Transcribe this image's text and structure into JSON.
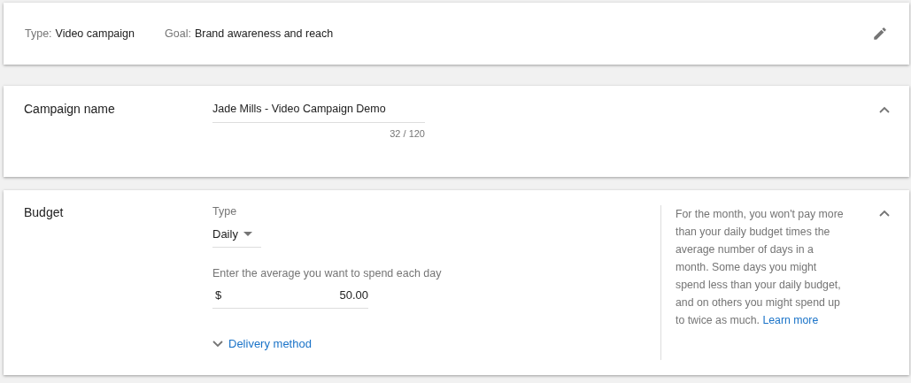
{
  "summary": {
    "items": [
      {
        "label": "Type:",
        "value": "Video campaign"
      },
      {
        "label": "Goal:",
        "value": "Brand awareness and reach"
      }
    ]
  },
  "campaign_name": {
    "title": "Campaign name",
    "expanded": true,
    "value": "Jade Mills - Video Campaign Demo",
    "counter": "32 / 120"
  },
  "budget": {
    "title": "Budget",
    "expanded": true,
    "type_label": "Type",
    "type_value": "Daily",
    "amount_label": "Enter the average you want to spend each day",
    "currency": "$",
    "amount": "50.00",
    "delivery": {
      "label": "Delivery method",
      "expanded": false
    },
    "help": "For the month, you won't pay more than your daily budget times the average number of days in a month. Some days you might spend less than your daily budget, and on others you might spend up to twice as much.",
    "help_link": "Learn more"
  }
}
